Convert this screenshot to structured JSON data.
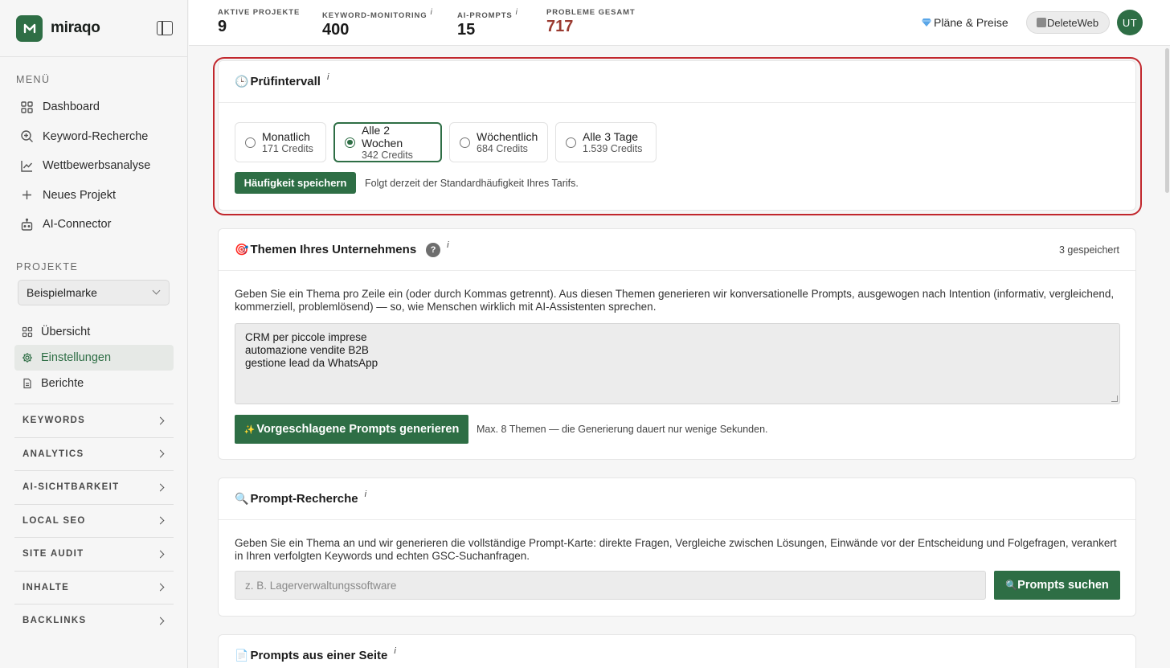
{
  "brand": {
    "name": "miraqo"
  },
  "sidebar": {
    "menu_label": "MENÜ",
    "nav": [
      {
        "label": "Dashboard",
        "icon": "grid-icon"
      },
      {
        "label": "Keyword-Recherche",
        "icon": "search-plus-icon"
      },
      {
        "label": "Wettbewerbsanalyse",
        "icon": "chart-line-icon"
      },
      {
        "label": "Neues Projekt",
        "icon": "plus-icon"
      },
      {
        "label": "AI-Connector",
        "icon": "robot-icon"
      }
    ],
    "projects_label": "PROJEKTE",
    "project_select": "Beispielmarke",
    "sub_nav": [
      {
        "label": "Übersicht",
        "icon": "grid-icon"
      },
      {
        "label": "Einstellungen",
        "icon": "gear-icon",
        "active": true
      },
      {
        "label": "Berichte",
        "icon": "document-icon"
      }
    ],
    "groups": [
      "KEYWORDS",
      "ANALYTICS",
      "AI-SICHTBARKEIT",
      "LOCAL SEO",
      "SITE AUDIT",
      "INHALTE",
      "BACKLINKS"
    ]
  },
  "topbar": {
    "stats": [
      {
        "label": "AKTIVE PROJEKTE",
        "value": "9",
        "info": ""
      },
      {
        "label": "KEYWORD-MONITORING",
        "value": "400",
        "info": "i"
      },
      {
        "label": "AI-PROMPTS",
        "value": "15",
        "info": "i"
      },
      {
        "label": "PROBLEME GESAMT",
        "value": "717",
        "info": ""
      }
    ],
    "plans": "Pläne & Preise",
    "user_chip": "DeleteWeb",
    "avatar": "UT"
  },
  "interval": {
    "emoji": "🕒",
    "title": "Prüfintervall",
    "info": "i",
    "options": [
      {
        "label": "Monatlich",
        "credits": "171 Credits",
        "selected": false
      },
      {
        "label": "Alle 2 Wochen",
        "credits": "342 Credits",
        "selected": true
      },
      {
        "label": "Wöchentlich",
        "credits": "684 Credits",
        "selected": false
      },
      {
        "label": "Alle 3 Tage",
        "credits": "1.539 Credits",
        "selected": false
      }
    ],
    "save_button": "Häufigkeit speichern",
    "note": "Folgt derzeit der Standardhäufigkeit Ihres Tarifs."
  },
  "topics": {
    "emoji": "🎯",
    "title": "Themen Ihres Unternehmens",
    "help": "?",
    "info": "i",
    "saved": "3 gespeichert",
    "description": "Geben Sie ein Thema pro Zeile ein (oder durch Kommas getrennt). Aus diesen Themen generieren wir konversationelle Prompts, ausgewogen nach Intention (informativ, vergleichend, kommerziell, problemlösend) — so, wie Menschen wirklich mit AI-Assistenten sprechen.",
    "lines": [
      "CRM per piccole imprese",
      "automazione vendite B2B",
      "gestione lead da WhatsApp"
    ],
    "generate_button": "Vorgeschlagene Prompts generieren",
    "generate_icon": "✨",
    "note": "Max. 8 Themen — die Generierung dauert nur wenige Sekunden."
  },
  "research": {
    "emoji": "🔍",
    "title": "Prompt-Recherche",
    "info": "i",
    "description": "Geben Sie ein Thema an und wir generieren die vollständige Prompt-Karte: direkte Fragen, Vergleiche zwischen Lösungen, Einwände vor der Entscheidung und Folgefragen, verankert in Ihren verfolgten Keywords und echten GSC-Suchanfragen.",
    "placeholder": "z. B. Lagerverwaltungssoftware",
    "search_button": "Prompts suchen",
    "search_icon": "🔍"
  },
  "from_page": {
    "emoji": "📄",
    "title": "Prompts aus einer Seite",
    "info": "i"
  },
  "colors": {
    "accent": "#2e6e45",
    "highlight": "#c1272d",
    "problem_red": "#9a3a30"
  }
}
